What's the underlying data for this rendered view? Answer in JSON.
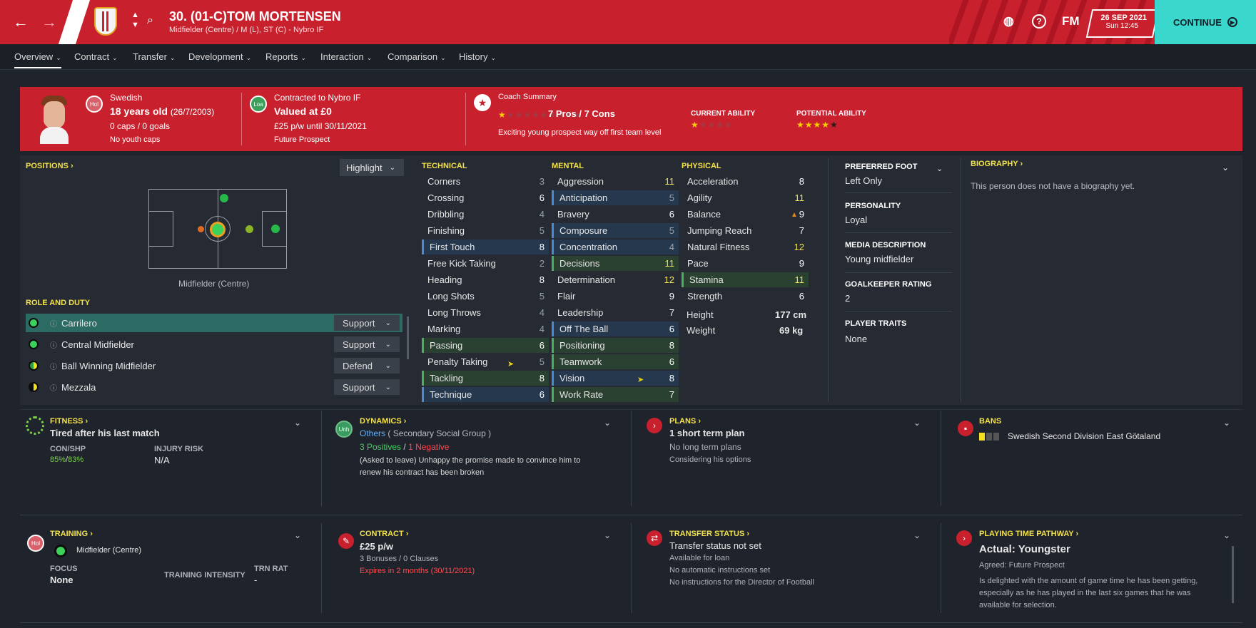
{
  "topbar": {
    "title": "30. (01-C)TOM MORTENSEN",
    "subtitle": "Midfielder (Centre) / M (L), ST (C) - Nybro IF",
    "fm_label": "FM",
    "date": "26 SEP 2021",
    "time": "Sun 12:45",
    "continue": "CONTINUE"
  },
  "tabs": [
    "Overview",
    "Contract",
    "Transfer",
    "Development",
    "Reports",
    "Interaction",
    "Comparison",
    "History"
  ],
  "header": {
    "hol": "Hol",
    "nationality": "Swedish",
    "age": "18 years old",
    "dob": "(26/7/2003)",
    "caps": "0 caps / 0 goals",
    "youth": "No youth caps",
    "loa": "Loa",
    "contracted": "Contracted to Nybro IF",
    "value": "Valued at £0",
    "wage": "£25 p/w until 30/11/2021",
    "status": "Future Prospect",
    "coach_title": "Coach Summary",
    "pros_cons": "7 Pros / 7 Cons",
    "coach_stars": 1,
    "coach_text": "Exciting young prospect way off first team level",
    "ca_label": "CURRENT ABILITY",
    "ca_stars": 1,
    "pa_label": "POTENTIAL ABILITY",
    "pa_stars": 4.5
  },
  "positions": {
    "title": "POSITIONS",
    "highlight": "Highlight",
    "pos_label": "Midfielder (Centre)",
    "role_title": "ROLE AND DUTY",
    "roles": [
      {
        "name": "Carrilero",
        "duty": "Support",
        "suit": "full"
      },
      {
        "name": "Central Midfielder",
        "duty": "Support",
        "suit": "full"
      },
      {
        "name": "Ball Winning Midfielder",
        "duty": "Defend",
        "suit": "half"
      },
      {
        "name": "Mezzala",
        "duty": "Support",
        "suit": "half"
      }
    ]
  },
  "technical": {
    "title": "TECHNICAL",
    "items": [
      [
        "Corners",
        "3"
      ],
      [
        "Crossing",
        "6"
      ],
      [
        "Dribbling",
        "4"
      ],
      [
        "Finishing",
        "5"
      ],
      [
        "First Touch",
        "8"
      ],
      [
        "Free Kick Taking",
        "2"
      ],
      [
        "Heading",
        "8"
      ],
      [
        "Long Shots",
        "5"
      ],
      [
        "Long Throws",
        "4"
      ],
      [
        "Marking",
        "4"
      ],
      [
        "Passing",
        "6"
      ],
      [
        "Penalty Taking",
        "5"
      ],
      [
        "Tackling",
        "8"
      ],
      [
        "Technique",
        "6"
      ]
    ]
  },
  "mental": {
    "title": "MENTAL",
    "items": [
      [
        "Aggression",
        "11"
      ],
      [
        "Anticipation",
        "5"
      ],
      [
        "Bravery",
        "6"
      ],
      [
        "Composure",
        "5"
      ],
      [
        "Concentration",
        "4"
      ],
      [
        "Decisions",
        "11"
      ],
      [
        "Determination",
        "12"
      ],
      [
        "Flair",
        "9"
      ],
      [
        "Leadership",
        "7"
      ],
      [
        "Off The Ball",
        "6"
      ],
      [
        "Positioning",
        "8"
      ],
      [
        "Teamwork",
        "6"
      ],
      [
        "Vision",
        "8"
      ],
      [
        "Work Rate",
        "7"
      ]
    ]
  },
  "physical": {
    "title": "PHYSICAL",
    "items": [
      [
        "Acceleration",
        "8"
      ],
      [
        "Agility",
        "11"
      ],
      [
        "Balance",
        "9"
      ],
      [
        "Jumping Reach",
        "7"
      ],
      [
        "Natural Fitness",
        "12"
      ],
      [
        "Pace",
        "9"
      ],
      [
        "Stamina",
        "11"
      ],
      [
        "Strength",
        "6"
      ]
    ],
    "height_label": "Height",
    "height": "177 cm",
    "weight_label": "Weight",
    "weight": "69 kg"
  },
  "info": {
    "foot_label": "PREFERRED FOOT",
    "foot": "Left Only",
    "pers_label": "PERSONALITY",
    "pers": "Loyal",
    "media_label": "MEDIA DESCRIPTION",
    "media": "Young midfielder",
    "gk_label": "GOALKEEPER RATING",
    "gk": "2",
    "traits_label": "PLAYER TRAITS",
    "traits": "None"
  },
  "bio": {
    "title": "BIOGRAPHY",
    "text": "This person does not have a biography yet."
  },
  "fitness": {
    "title": "FITNESS",
    "text": "Tired after his last match",
    "con_label": "CON/SHP",
    "con": "85%",
    "shp": "83%",
    "injury_label": "INJURY RISK",
    "injury": "N/A"
  },
  "dynamics": {
    "title": "DYNAMICS",
    "badge": "Unh",
    "group": "Others",
    "group_sub": "( Secondary Social Group )",
    "pos": "3 Positives",
    "neg": "1 Negative",
    "text1": "(Asked to leave) Unhappy the promise made to convince him to",
    "text2": "renew his contract has been broken"
  },
  "plans": {
    "title": "PLANS",
    "text": "1 short term plan",
    "l1": "No long term plans",
    "l2": "Considering his options"
  },
  "bans": {
    "title": "BANS",
    "text": "Swedish Second Division East Götaland"
  },
  "training": {
    "title": "TRAINING",
    "badge": "Hol",
    "pos": "Midfielder (Centre)",
    "focus_label": "FOCUS",
    "focus": "None",
    "int_label": "TRAINING INTENSITY",
    "trn_label": "TRN RAT",
    "trn": "-"
  },
  "contract": {
    "title": "CONTRACT",
    "wage": "£25 p/w",
    "clauses": "3 Bonuses / 0 Clauses",
    "expires": "Expires in 2 months  (30/11/2021)"
  },
  "transfer": {
    "title": "TRANSFER STATUS",
    "text": "Transfer status not set",
    "l1": "Available for loan",
    "l2": "No automatic instructions set",
    "l3": "No instructions for the Director of Football"
  },
  "pathway": {
    "title": "PLAYING TIME PATHWAY",
    "actual": "Actual: Youngster",
    "agreed_label": "Agreed:",
    "agreed": "Future Prospect",
    "t1": "Is delighted with the amount of game time he has been getting,",
    "t2": "especially as he has played in the last six games that he was",
    "t3": "available for selection."
  }
}
